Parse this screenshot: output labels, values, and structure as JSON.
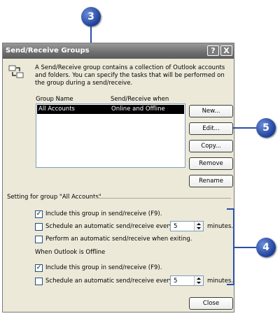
{
  "dialog": {
    "title": "Send/Receive Groups",
    "description": "A Send/Receive group contains a collection of Outlook accounts and folders. You can specify the tasks that will be performed on the group during a send/receive.",
    "columns": {
      "name": "Group Name",
      "when": "Send/Receive when"
    },
    "rows": [
      {
        "name": "All Accounts",
        "when": "Online and Offline"
      }
    ],
    "buttons": {
      "new": "New...",
      "edit": "Edit...",
      "copy": "Copy...",
      "remove": "Remove",
      "rename": "Rename",
      "close": "Close",
      "help": "?",
      "x": "X"
    },
    "setting_label": "Setting for group \"All Accounts\"",
    "online": {
      "include": "Include this group in send/receive (F9).",
      "schedule": "Schedule an automatic send/receive every",
      "schedule_value": "5",
      "minutes": "minutes.",
      "exit": "Perform an automatic send/receive when exiting."
    },
    "offline_label": "When Outlook is Offline",
    "offline": {
      "include": "Include this group in send/receive (F9).",
      "schedule": "Schedule an automatic send/receive every",
      "schedule_value": "5",
      "minutes": "minutes."
    },
    "checks": {
      "online_include": true,
      "online_schedule": false,
      "online_exit": false,
      "offline_include": true,
      "offline_schedule": false
    }
  },
  "callouts": {
    "c3": "3",
    "c4": "4",
    "c5": "5"
  },
  "colors": {
    "callout": "#1d3f99",
    "titlebar": "#6e6e6e"
  }
}
